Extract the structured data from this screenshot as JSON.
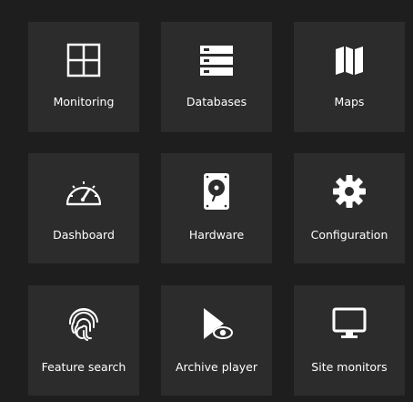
{
  "tiles": [
    {
      "label": "Monitoring",
      "icon": "grid-icon"
    },
    {
      "label": "Databases",
      "icon": "database-icon"
    },
    {
      "label": "Maps",
      "icon": "map-icon"
    },
    {
      "label": "Dashboard",
      "icon": "speedometer-icon"
    },
    {
      "label": "Hardware",
      "icon": "hard-drive-icon"
    },
    {
      "label": "Configuration",
      "icon": "gear-icon"
    },
    {
      "label": "Feature search",
      "icon": "fingerprint-icon"
    },
    {
      "label": "Archive player",
      "icon": "play-eye-icon"
    },
    {
      "label": "Site monitors",
      "icon": "monitor-icon"
    }
  ],
  "colors": {
    "background": "#1e1e1e",
    "tile": "#2c2c2c",
    "foreground": "#ffffff"
  }
}
